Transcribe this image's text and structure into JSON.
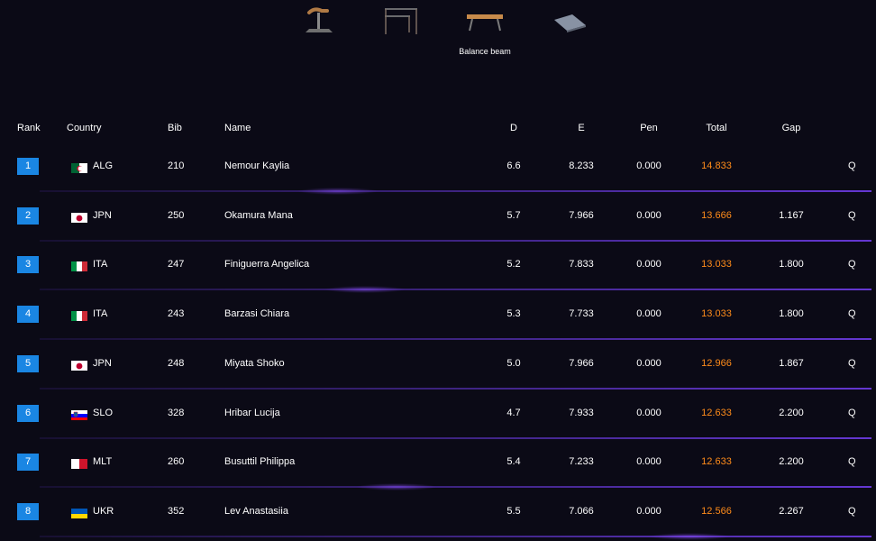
{
  "apparatus": [
    {
      "name": "pommel-horse-icon",
      "label": ""
    },
    {
      "name": "uneven-bars-icon",
      "label": ""
    },
    {
      "name": "balance-beam-icon",
      "label": "Balance beam"
    },
    {
      "name": "floor-icon",
      "label": ""
    }
  ],
  "columns": {
    "rank": "Rank",
    "country": "Country",
    "bib": "Bib",
    "name": "Name",
    "d": "D",
    "e": "E",
    "pen": "Pen",
    "total": "Total",
    "gap": "Gap"
  },
  "rows": [
    {
      "rank": "1",
      "country": "ALG",
      "flag": "alg",
      "bib": "210",
      "name": "Nemour Kaylia",
      "d": "6.6",
      "e": "8.233",
      "pen": "0.000",
      "total": "14.833",
      "gap": "",
      "q": "Q"
    },
    {
      "rank": "2",
      "country": "JPN",
      "flag": "jpn",
      "bib": "250",
      "name": "Okamura Mana",
      "d": "5.7",
      "e": "7.966",
      "pen": "0.000",
      "total": "13.666",
      "gap": "1.167",
      "q": "Q"
    },
    {
      "rank": "3",
      "country": "ITA",
      "flag": "ita",
      "bib": "247",
      "name": "Finiguerra Angelica",
      "d": "5.2",
      "e": "7.833",
      "pen": "0.000",
      "total": "13.033",
      "gap": "1.800",
      "q": "Q"
    },
    {
      "rank": "4",
      "country": "ITA",
      "flag": "ita",
      "bib": "243",
      "name": "Barzasi Chiara",
      "d": "5.3",
      "e": "7.733",
      "pen": "0.000",
      "total": "13.033",
      "gap": "1.800",
      "q": "Q"
    },
    {
      "rank": "5",
      "country": "JPN",
      "flag": "jpn",
      "bib": "248",
      "name": "Miyata Shoko",
      "d": "5.0",
      "e": "7.966",
      "pen": "0.000",
      "total": "12.966",
      "gap": "1.867",
      "q": "Q"
    },
    {
      "rank": "6",
      "country": "SLO",
      "flag": "slo",
      "bib": "328",
      "name": "Hribar Lucija",
      "d": "4.7",
      "e": "7.933",
      "pen": "0.000",
      "total": "12.633",
      "gap": "2.200",
      "q": "Q"
    },
    {
      "rank": "7",
      "country": "MLT",
      "flag": "mlt",
      "bib": "260",
      "name": "Busuttil Philippa",
      "d": "5.4",
      "e": "7.233",
      "pen": "0.000",
      "total": "12.633",
      "gap": "2.200",
      "q": "Q"
    },
    {
      "rank": "8",
      "country": "UKR",
      "flag": "ukr",
      "bib": "352",
      "name": "Lev Anastasiia",
      "d": "5.5",
      "e": "7.066",
      "pen": "0.000",
      "total": "12.566",
      "gap": "2.267",
      "q": "Q"
    }
  ],
  "colors": {
    "accent": "#1a86e3",
    "total": "#ff8c1a",
    "background": "#0b0a16",
    "divider": "#6e3ce6"
  }
}
